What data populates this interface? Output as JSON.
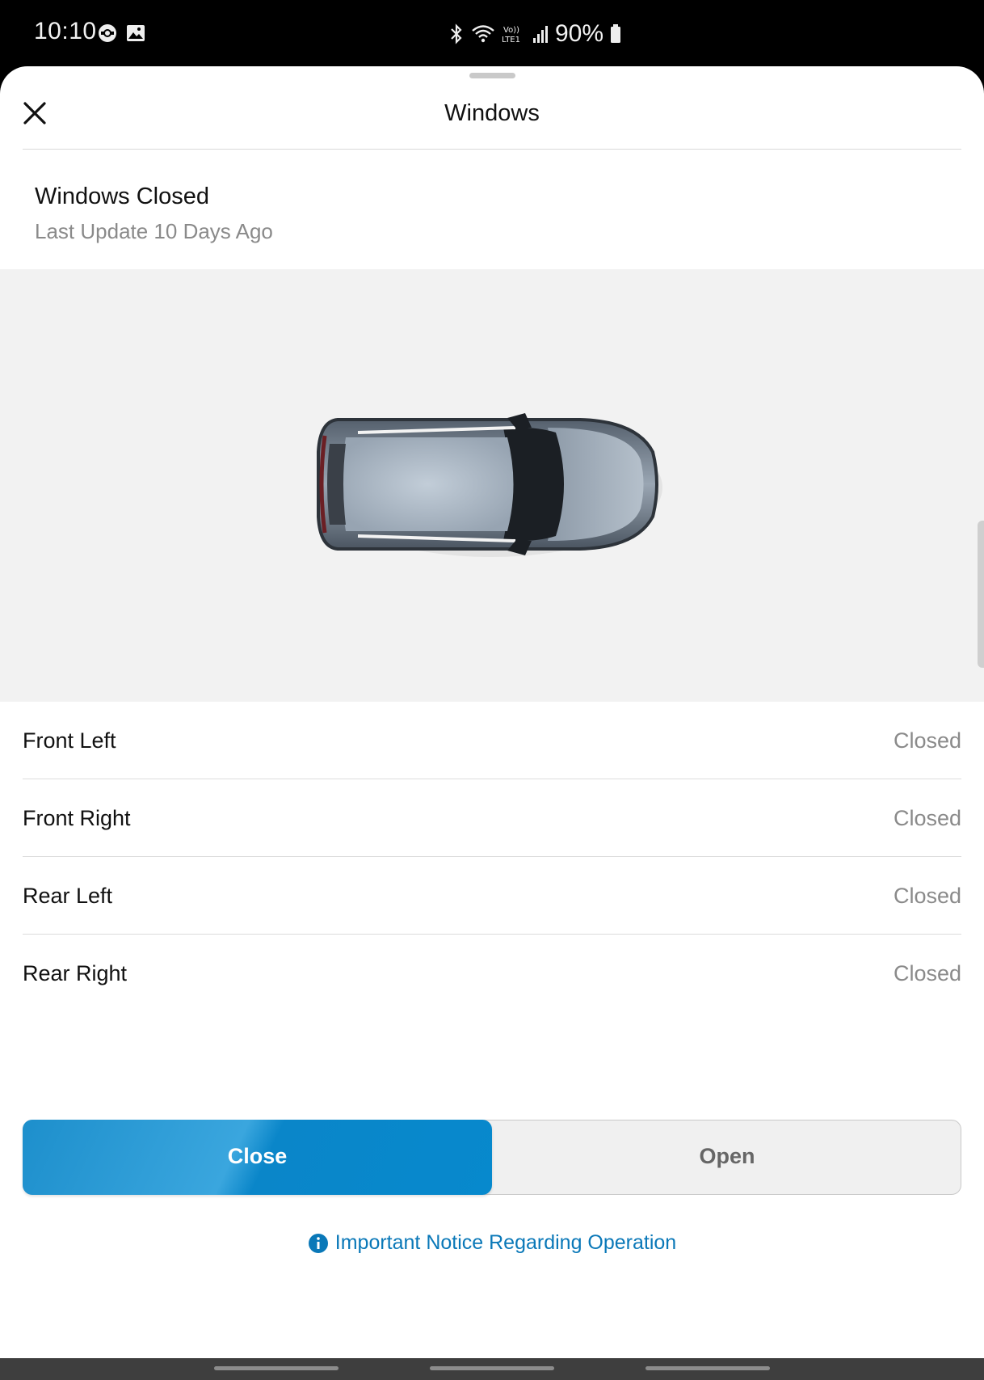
{
  "status_bar": {
    "time": "10:10",
    "battery_percent": "90%",
    "icons": [
      "sync-icon",
      "image-icon",
      "bluetooth-icon",
      "wifi-icon",
      "volte-icon",
      "signal-icon",
      "battery-icon"
    ],
    "volte_text": "Vo)) LTE1"
  },
  "header": {
    "title": "Windows",
    "close_icon": "close-icon"
  },
  "summary": {
    "status": "Windows Closed",
    "last_update": "Last Update 10 Days Ago"
  },
  "windows": [
    {
      "label": "Front Left",
      "state": "Closed"
    },
    {
      "label": "Front Right",
      "state": "Closed"
    },
    {
      "label": "Rear Left",
      "state": "Closed"
    },
    {
      "label": "Rear Right",
      "state": "Closed"
    }
  ],
  "controls": {
    "close_label": "Close",
    "open_label": "Open",
    "selected": "Close"
  },
  "notice": {
    "text": "Important Notice Regarding Operation",
    "icon": "info-icon"
  },
  "colors": {
    "accent": "#0789cd",
    "link": "#0a78b8",
    "panel_bg": "#f2f2f2"
  }
}
